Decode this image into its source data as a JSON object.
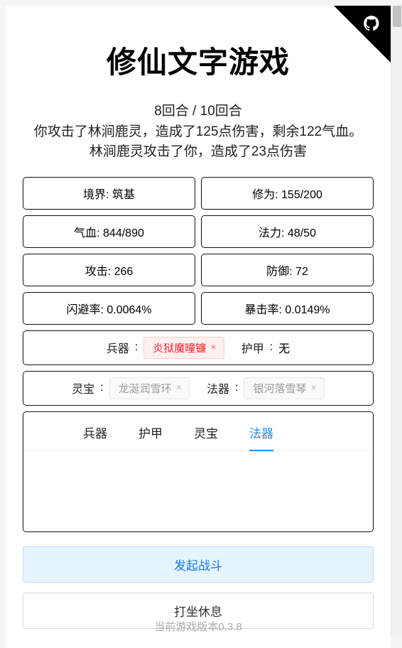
{
  "title": "修仙文字游戏",
  "round": {
    "current": 8,
    "total": 10,
    "sep": "回合 / ",
    "suffix": "回合"
  },
  "battle_log": [
    "你攻击了林涧鹿灵，造成了125点伤害，剩余122气血。",
    "林涧鹿灵攻击了你，造成了23点伤害"
  ],
  "stats": {
    "realm": {
      "label": "境界",
      "value": "筑基"
    },
    "cultiv": {
      "label": "修为",
      "value": "155/200"
    },
    "hp": {
      "label": "气血",
      "value": "844/890"
    },
    "mp": {
      "label": "法力",
      "value": "48/50"
    },
    "atk": {
      "label": "攻击",
      "value": "266"
    },
    "def": {
      "label": "防御",
      "value": "72"
    },
    "dodge": {
      "label": "闪避率",
      "value": "0.0064%"
    },
    "crit": {
      "label": "暴击率",
      "value": "0.0149%"
    }
  },
  "equip": {
    "weapon": {
      "label": "兵器",
      "item": "炎狱魔曈镰",
      "has": true,
      "color": "red"
    },
    "armor": {
      "label": "护甲",
      "item": "无",
      "has": false
    },
    "treasure": {
      "label": "灵宝",
      "item": "龙涎润雪环",
      "has": true,
      "color": "grey"
    },
    "tool": {
      "label": "法器",
      "item": "银河落雪琴",
      "has": true,
      "color": "grey"
    }
  },
  "tabs": [
    "兵器",
    "护甲",
    "灵宝",
    "法器"
  ],
  "active_tab": 3,
  "actions": {
    "fight": "发起战斗",
    "rest": "打坐休息"
  },
  "version": "当前游戏版本0.3.8"
}
